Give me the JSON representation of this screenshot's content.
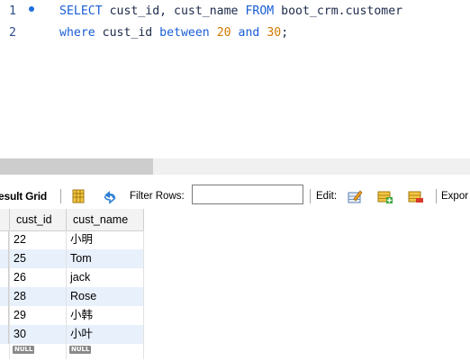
{
  "editor": {
    "lines": [
      {
        "num": "1",
        "tokens": [
          {
            "t": "SELECT",
            "c": "kw"
          },
          {
            "t": " cust_id, cust_name ",
            "c": "plain"
          },
          {
            "t": "FROM",
            "c": "kw"
          },
          {
            "t": " boot_crm.customer",
            "c": "plain"
          }
        ]
      },
      {
        "num": "2",
        "tokens": [
          {
            "t": "where",
            "c": "kw"
          },
          {
            "t": " cust_id ",
            "c": "plain"
          },
          {
            "t": "between",
            "c": "kw"
          },
          {
            "t": " ",
            "c": "plain"
          },
          {
            "t": "20",
            "c": "num-lit"
          },
          {
            "t": " ",
            "c": "plain"
          },
          {
            "t": "and",
            "c": "kw"
          },
          {
            "t": " ",
            "c": "plain"
          },
          {
            "t": "30",
            "c": "num-lit"
          },
          {
            "t": ";",
            "c": "plain"
          }
        ]
      }
    ]
  },
  "toolbar": {
    "result_grid_label": "esult Grid",
    "filter_rows_label": "Filter Rows:",
    "filter_value": "",
    "edit_label": "Edit:",
    "export_label": "Expor"
  },
  "grid": {
    "columns": [
      "cust_id",
      "cust_name"
    ],
    "rows": [
      [
        "22",
        "小明"
      ],
      [
        "25",
        "Tom"
      ],
      [
        "26",
        "jack"
      ],
      [
        "28",
        "Rose"
      ],
      [
        "29",
        "小韩"
      ],
      [
        "30",
        "小叶"
      ]
    ],
    "null_label": "NULL"
  },
  "colors": {
    "keyword": "#1a5ed6",
    "number": "#d07a00",
    "alt_row": "#e8f0fb"
  }
}
